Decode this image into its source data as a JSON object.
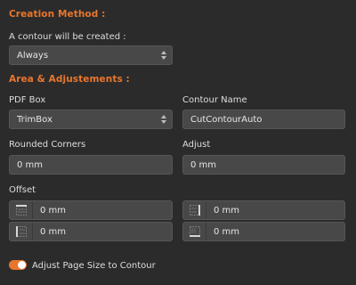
{
  "creation": {
    "title": "Creation Method :",
    "contour_label": "A contour will be created :",
    "contour_select_value": "Always"
  },
  "area": {
    "title": "Area & Adjustements :",
    "pdf_box_label": "PDF Box",
    "pdf_box_value": "TrimBox",
    "contour_name_label": "Contour Name",
    "contour_name_value": "CutContourAuto",
    "rounded_corners_label": "Rounded Corners",
    "rounded_corners_value": "0 mm",
    "adjust_label": "Adjust",
    "adjust_value": "0 mm",
    "offset_label": "Offset",
    "offset_top": "0 mm",
    "offset_right": "0 mm",
    "offset_left": "0 mm",
    "offset_bottom": "0 mm"
  },
  "adjust_page": {
    "label": "Adjust Page Size to Contour",
    "enabled": true
  },
  "colors": {
    "accent": "#e8762d",
    "background": "#2b2b2b",
    "field": "#484848"
  },
  "icons": {
    "select_arrows": "up-down-arrows-icon",
    "offset_top": "offset-top-icon",
    "offset_right": "offset-right-icon",
    "offset_left": "offset-left-icon",
    "offset_bottom": "offset-bottom-icon"
  }
}
